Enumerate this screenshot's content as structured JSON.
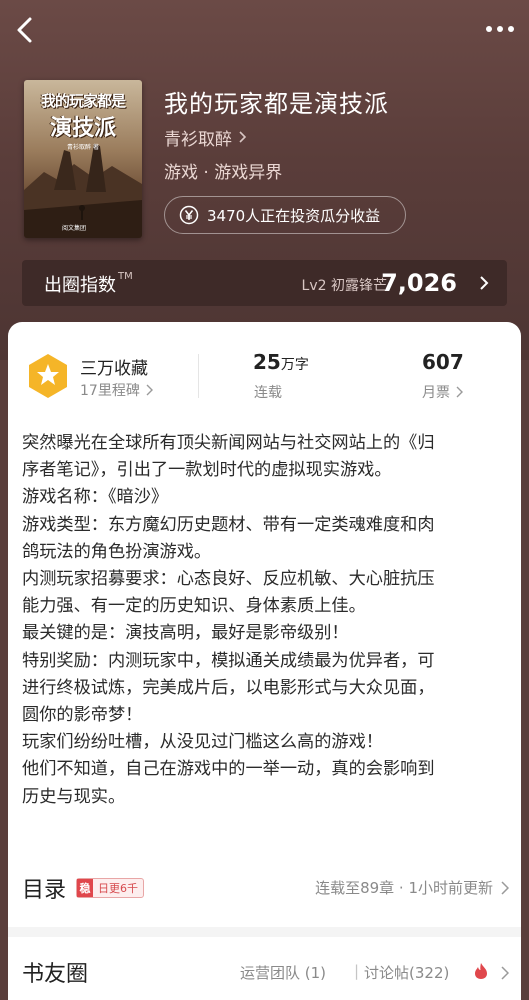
{
  "colors": {
    "hero_bg": "#5a3e3b",
    "accent_red": "#e0474c",
    "medal_gold": "#f5b528"
  },
  "header": {
    "back_icon": "chevron-left-icon",
    "more_icon": "more-dots-icon"
  },
  "book": {
    "cover": {
      "title_line1": "我的玩家都是",
      "title_line2": "演技派",
      "author_small": "青衫取醉 著",
      "publisher_small": "阅文集团"
    },
    "title": "我的玩家都是演技派",
    "author": "青衫取醉",
    "genre": "游戏 · 游戏异界",
    "invest_text": "3470人正在投资瓜分收益",
    "invest_icon": "yen-icon"
  },
  "index": {
    "label": "出圈指数",
    "tm": "TM",
    "level": "Lv2 初露锋芒",
    "value": "7,026"
  },
  "stats": {
    "collect_main": "三万收藏",
    "collect_sub": "17里程碑",
    "words_value": "25",
    "words_unit": "万字",
    "words_sub": "连载",
    "tickets_value": "607",
    "tickets_sub": "月票"
  },
  "synopsis": {
    "lines": [
      "突然曝光在全球所有顶尖新闻网站与社交网站上的《归",
      "序者笔记》，引出了一款划时代的虚拟现实游戏。",
      "游戏名称：《暗沙》",
      "游戏类型：东方魔幻历史题材、带有一定类魂难度和肉",
      "鸽玩法的角色扮演游戏。",
      "内测玩家招募要求：心态良好、反应机敏、大心脏抗压",
      "能力强、有一定的历史知识、身体素质上佳。",
      "最关键的是：演技高明，最好是影帝级别！",
      "特别奖励：内测玩家中，模拟通关成绩最为优异者，可",
      "进行终极试炼，完美成片后，以电影形式与大众见面，",
      "圆你的影帝梦！",
      "玩家们纷纷吐槽，从没见过门槛这么高的游戏！",
      "他们不知道，自己在游戏中的一举一动，真的会影响到",
      "历史与现实。"
    ]
  },
  "toc": {
    "title": "目录",
    "badge_tag": "稳",
    "badge_text": "日更6千",
    "status": "连载至89章 · 1小时前更新"
  },
  "club": {
    "title": "书友圈",
    "ops": "运营团队 (1)",
    "separator": "|",
    "posts": "讨论帖(322)"
  }
}
